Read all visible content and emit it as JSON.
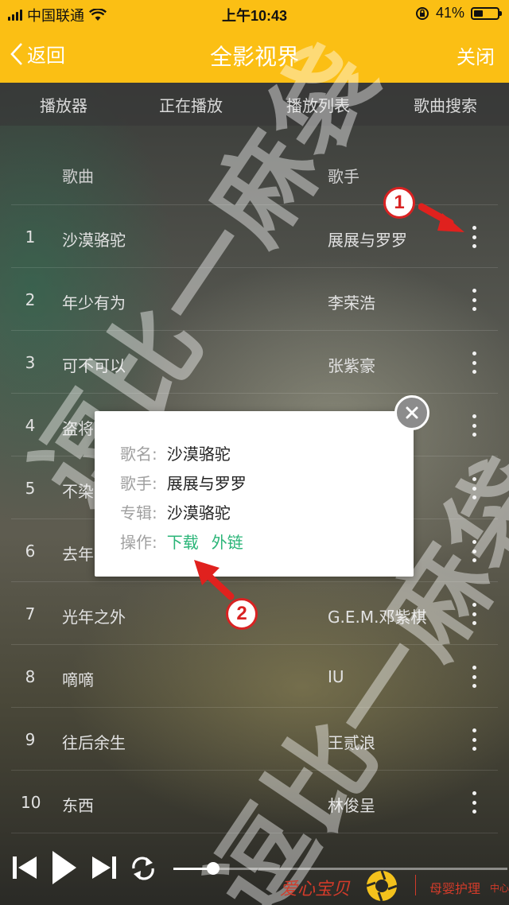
{
  "status_bar": {
    "carrier": "中国联通",
    "time": "上午10:43",
    "battery": "41%",
    "battery_level": 0.41
  },
  "navbar": {
    "back_label": "返回",
    "title": "全影视界",
    "close_label": "关闭"
  },
  "tabs": [
    "播放器",
    "正在播放",
    "播放列表",
    "歌曲搜索"
  ],
  "table": {
    "header_song": "歌曲",
    "header_singer": "歌手",
    "rows": [
      {
        "num": "1",
        "song": "沙漠骆驼",
        "singer": "展展与罗罗"
      },
      {
        "num": "2",
        "song": "年少有为",
        "singer": "李荣浩"
      },
      {
        "num": "3",
        "song": "可不可以",
        "singer": "张紫豪"
      },
      {
        "num": "4",
        "song": "盗将",
        "singer": ""
      },
      {
        "num": "5",
        "song": "不染",
        "singer": ""
      },
      {
        "num": "6",
        "song": "去年",
        "singer": ""
      },
      {
        "num": "7",
        "song": "光年之外",
        "singer": "G.E.M.邓紫棋"
      },
      {
        "num": "8",
        "song": "嘀嘀",
        "singer": "IU"
      },
      {
        "num": "9",
        "song": "往后余生",
        "singer": "王贰浪"
      },
      {
        "num": "10",
        "song": "东西",
        "singer": "林俊呈"
      }
    ]
  },
  "popup": {
    "name_label": "歌名:",
    "name_value": "沙漠骆驼",
    "singer_label": "歌手:",
    "singer_value": "展展与罗罗",
    "album_label": "专辑:",
    "album_value": "沙漠骆驼",
    "action_label": "操作:",
    "download_label": "下载",
    "external_link_label": "外链"
  },
  "player": {
    "progress": 0.12
  },
  "annotations": {
    "marker_1": "1",
    "marker_2": "2"
  },
  "watermark": {
    "text_1": "逗比一麻袋",
    "text_2": "逗比一麻袋"
  },
  "brand": {
    "name": "爱心宝贝",
    "tagline": "母婴护理",
    "suffix": "中心"
  },
  "colors": {
    "accent": "#fbbf14",
    "link_green": "#2bb578",
    "marker_red": "#d92222"
  }
}
